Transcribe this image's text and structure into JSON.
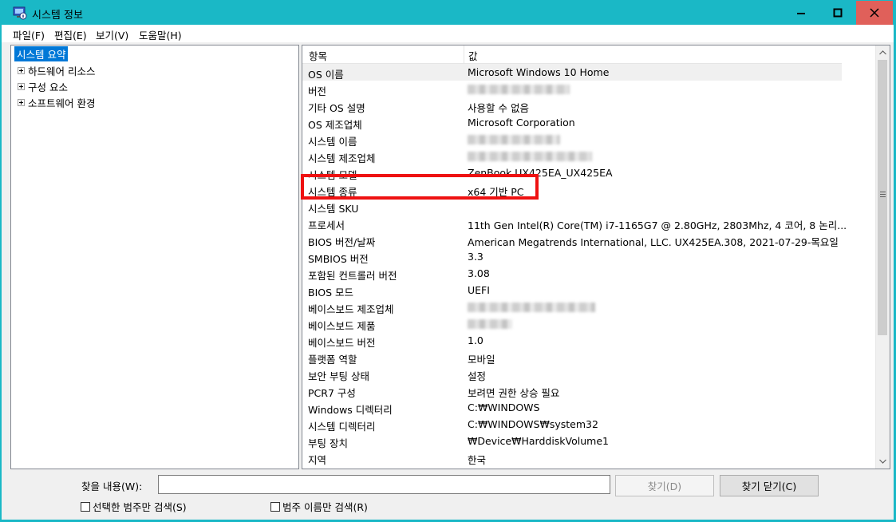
{
  "window": {
    "title": "시스템 정보",
    "icon": "system-information-icon",
    "controls": [
      "minimize-icon",
      "maximize-icon",
      "close-icon"
    ]
  },
  "menu": {
    "file": "파일(F)",
    "edit": "편집(E)",
    "view": "보기(V)",
    "help": "도움말(H)"
  },
  "tree": {
    "selected": "시스템 요약",
    "hardware": "하드웨어 리소스",
    "components": "구성 요소",
    "software": "소프트웨어 환경"
  },
  "list": {
    "col_item": "항목",
    "col_value": "값",
    "rows": [
      {
        "item": "OS 이름",
        "value": "Microsoft Windows 10 Home"
      },
      {
        "item": "버전",
        "value": ""
      },
      {
        "item": "기타 OS 설명",
        "value": "사용할 수 없음"
      },
      {
        "item": "OS 제조업체",
        "value": "Microsoft Corporation"
      },
      {
        "item": "시스템 이름",
        "value": ""
      },
      {
        "item": "시스템 제조업체",
        "value": ""
      },
      {
        "item": "시스템 모델",
        "value": "ZenBook UX425EA_UX425EA"
      },
      {
        "item": "시스템 종류",
        "value": "x64 기반 PC"
      },
      {
        "item": "시스템 SKU",
        "value": ""
      },
      {
        "item": "프로세서",
        "value": "11th Gen Intel(R) Core(TM) i7-1165G7 @ 2.80GHz, 2803Mhz, 4 코어, 8 논리..."
      },
      {
        "item": "BIOS 버전/날짜",
        "value": "American Megatrends International, LLC. UX425EA.308, 2021-07-29-목요일"
      },
      {
        "item": "SMBIOS 버전",
        "value": "3.3"
      },
      {
        "item": "포함된 컨트롤러 버전",
        "value": "3.08"
      },
      {
        "item": "BIOS 모드",
        "value": "UEFI"
      },
      {
        "item": "베이스보드 제조업체",
        "value": ""
      },
      {
        "item": "베이스보드 제품",
        "value": ""
      },
      {
        "item": "베이스보드 버전",
        "value": "1.0"
      },
      {
        "item": "플랫폼 역할",
        "value": "모바일"
      },
      {
        "item": "보안 부팅 상태",
        "value": "설정"
      },
      {
        "item": "PCR7 구성",
        "value": "보려면 권한 상승 필요"
      },
      {
        "item": "Windows 디렉터리",
        "value": "C:₩WINDOWS"
      },
      {
        "item": "시스템 디렉터리",
        "value": "C:₩WINDOWS₩system32"
      },
      {
        "item": "부팅 장치",
        "value": "₩Device₩HarddiskVolume1"
      },
      {
        "item": "지역",
        "value": "한국"
      }
    ]
  },
  "find": {
    "label": "찾을 내용(W):",
    "value": "",
    "find_button": "찾기(D)",
    "close_button": "찾기 닫기(C)",
    "check_selected": "선택한 범주만 검색(S)",
    "check_names": "범주 이름만 검색(R)"
  },
  "colors": {
    "titlebar": "#1ab8c6",
    "selection": "#0078d7",
    "highlight_box": "#ee1111"
  }
}
